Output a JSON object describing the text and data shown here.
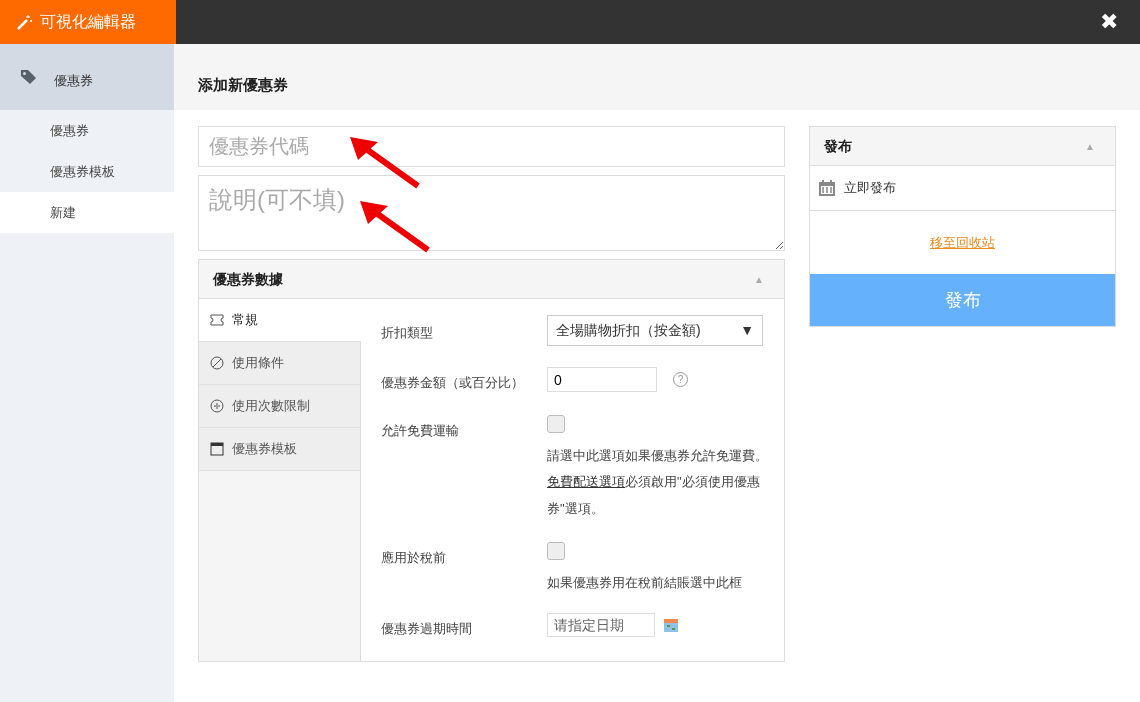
{
  "app_bar": {
    "title": "可視化編輯器",
    "close": "✖"
  },
  "sidebar": {
    "section": {
      "label": "優惠券"
    },
    "items": [
      {
        "label": "優惠券",
        "selected": false
      },
      {
        "label": "優惠券模板",
        "selected": false
      },
      {
        "label": "新建",
        "selected": true
      }
    ]
  },
  "page_title": "添加新優惠券",
  "code_field": {
    "placeholder": "優惠券代碼"
  },
  "description_field": {
    "placeholder": "說明(可不填)"
  },
  "annotations": [
    {
      "kind": "arrow"
    },
    {
      "kind": "arrow"
    }
  ],
  "coupon_data": {
    "title": "優惠券數據",
    "toggle": "▲",
    "tabs": [
      {
        "label": "常規",
        "selected": true
      },
      {
        "label": "使用條件",
        "selected": false
      },
      {
        "label": "使用次數限制",
        "selected": false
      },
      {
        "label": "優惠券模板",
        "selected": false
      }
    ],
    "fields": [
      {
        "kind": "select",
        "label": "折扣類型",
        "value": "全場購物折扣（按金額)",
        "caret": "▼"
      },
      {
        "kind": "number",
        "label": "優惠券金額（或百分比）",
        "value": "0",
        "help": "?"
      },
      {
        "kind": "checkbox",
        "label": "允許免費運輸",
        "checked": false,
        "description": [
          {
            "text": "請選中此選項如果優惠券允許免運費。"
          },
          {
            "text": "免費配送選項",
            "link": true
          },
          {
            "text": "必須啟用\"必須使用優惠券\"選項。"
          }
        ]
      },
      {
        "kind": "checkbox",
        "label": "應用於稅前",
        "checked": false,
        "description": [
          {
            "text": "如果優惠券用在稅前結賬選中此框"
          }
        ]
      },
      {
        "kind": "date",
        "label": "優惠券過期時間",
        "placeholder": "请指定日期"
      }
    ]
  },
  "publish": {
    "title": "發布",
    "toggle": "▲",
    "schedule": "立即發布",
    "trash_link": "移至回收站",
    "button": "發布"
  }
}
